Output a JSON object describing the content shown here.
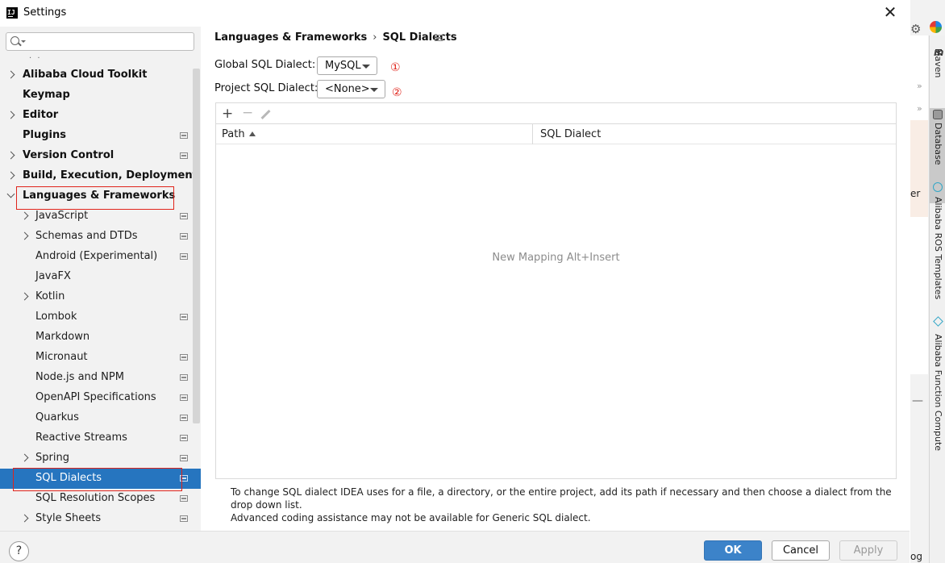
{
  "window": {
    "title": "Settings",
    "close_glyph": "✕",
    "logo_icon": "intellij-icon"
  },
  "search": {
    "value": "",
    "placeholder": ""
  },
  "tree": {
    "scroll_dots": "· ·",
    "items": [
      {
        "label": "Alibaba Cloud Toolkit",
        "level": 0,
        "expandable": true,
        "project_scoped": false
      },
      {
        "label": "Keymap",
        "level": 0,
        "expandable": false,
        "project_scoped": false
      },
      {
        "label": "Editor",
        "level": 0,
        "expandable": true,
        "project_scoped": false
      },
      {
        "label": "Plugins",
        "level": 0,
        "expandable": false,
        "project_scoped": true
      },
      {
        "label": "Version Control",
        "level": 0,
        "expandable": true,
        "project_scoped": true
      },
      {
        "label": "Build, Execution, Deployment",
        "level": 0,
        "expandable": true,
        "project_scoped": false
      },
      {
        "label": "Languages & Frameworks",
        "level": 0,
        "expandable": true,
        "expanded": true,
        "project_scoped": false
      },
      {
        "label": "JavaScript",
        "level": 1,
        "expandable": true,
        "project_scoped": true
      },
      {
        "label": "Schemas and DTDs",
        "level": 1,
        "expandable": true,
        "project_scoped": true
      },
      {
        "label": "Android (Experimental)",
        "level": 1,
        "expandable": false,
        "project_scoped": true
      },
      {
        "label": "JavaFX",
        "level": 1,
        "expandable": false,
        "project_scoped": false
      },
      {
        "label": "Kotlin",
        "level": 1,
        "expandable": true,
        "project_scoped": false
      },
      {
        "label": "Lombok",
        "level": 1,
        "expandable": false,
        "project_scoped": true
      },
      {
        "label": "Markdown",
        "level": 1,
        "expandable": false,
        "project_scoped": false
      },
      {
        "label": "Micronaut",
        "level": 1,
        "expandable": false,
        "project_scoped": true
      },
      {
        "label": "Node.js and NPM",
        "level": 1,
        "expandable": false,
        "project_scoped": true
      },
      {
        "label": "OpenAPI Specifications",
        "level": 1,
        "expandable": false,
        "project_scoped": true
      },
      {
        "label": "Quarkus",
        "level": 1,
        "expandable": false,
        "project_scoped": true
      },
      {
        "label": "Reactive Streams",
        "level": 1,
        "expandable": false,
        "project_scoped": true
      },
      {
        "label": "Spring",
        "level": 1,
        "expandable": true,
        "project_scoped": true
      },
      {
        "label": "SQL Dialects",
        "level": 1,
        "expandable": false,
        "project_scoped": true,
        "selected": true
      },
      {
        "label": "SQL Resolution Scopes",
        "level": 1,
        "expandable": false,
        "project_scoped": true
      },
      {
        "label": "Style Sheets",
        "level": 1,
        "expandable": true,
        "project_scoped": true
      }
    ]
  },
  "content": {
    "breadcrumb": [
      "Languages & Frameworks",
      "SQL Dialects"
    ],
    "breadcrumb_sep": "›",
    "global_label": "Global SQL Dialect:",
    "global_value": "MySQL",
    "project_label": "Project SQL Dialect:",
    "project_value": "<None>",
    "annotation_1": "①",
    "annotation_2": "②",
    "toolbar": {
      "add_glyph": "+",
      "remove_glyph": "−"
    },
    "table": {
      "columns": [
        "Path",
        "SQL Dialect"
      ],
      "sort_column": "Path",
      "empty_text": "New Mapping Alt+Insert"
    },
    "hint_line1": "To change SQL dialect IDEA uses for a file, a directory, or the entire project, add its path if necessary and then choose a dialect from the drop down list.",
    "hint_line2": "Advanced coding assistance may not be available for Generic SQL dialect."
  },
  "buttons": {
    "help": "?",
    "ok": "OK",
    "cancel": "Cancel",
    "apply": "Apply"
  },
  "ide_background": {
    "gear_glyph": "⚙",
    "chevron_glyph": "»",
    "fragment_er": "er",
    "fragment_og": "og",
    "minus_glyph": "—",
    "tool_windows": [
      "Maven",
      "Database",
      "Alibaba ROS Templates",
      "Alibaba Function Compute"
    ],
    "maven_glyph": "m"
  },
  "colors": {
    "selection": "#2675bf",
    "annotation_red": "#e0241b",
    "ok_button": "#3c83c9"
  }
}
